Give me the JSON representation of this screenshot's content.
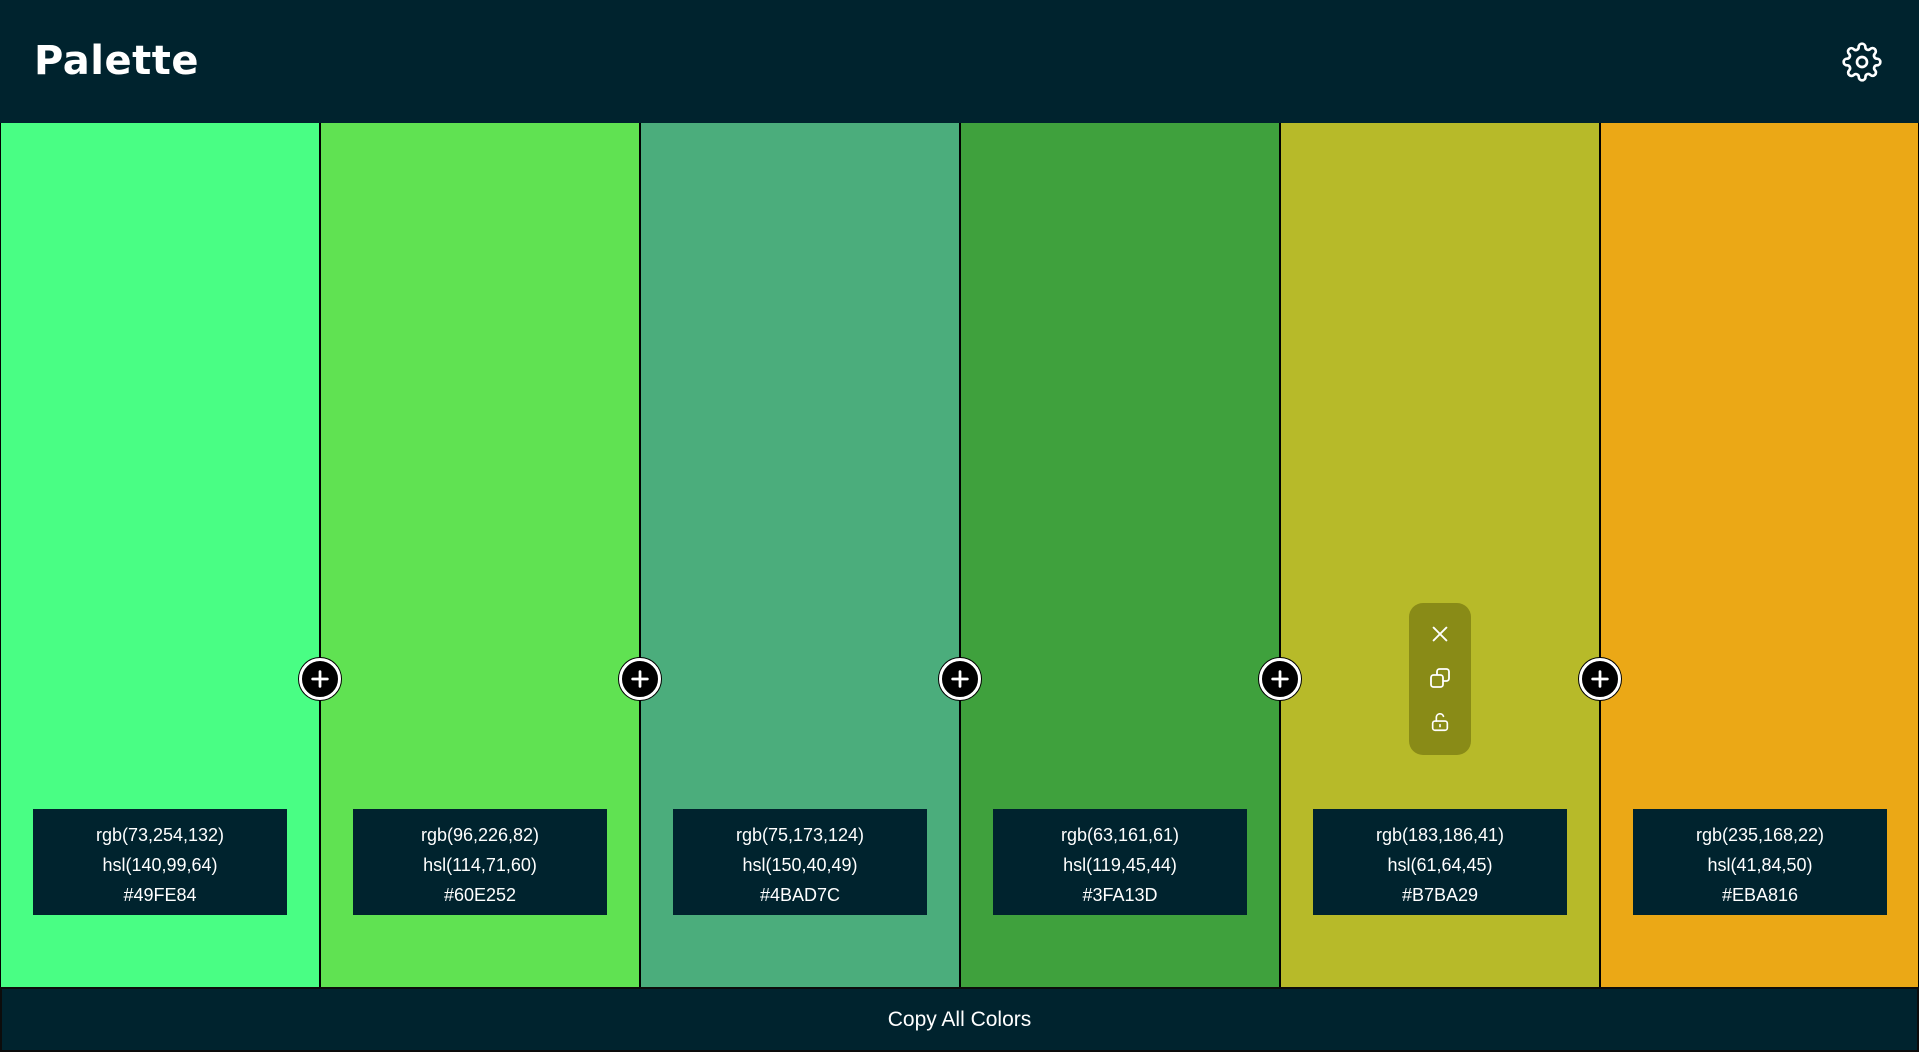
{
  "header": {
    "title": "Palette",
    "settings_icon": "gear-icon"
  },
  "palette": {
    "colors": [
      {
        "hex_value": "#49FE84",
        "rgb": "rgb(73,254,132)",
        "hsl": "hsl(140,99,64)",
        "hex": "#49FE84"
      },
      {
        "hex_value": "#60E252",
        "rgb": "rgb(96,226,82)",
        "hsl": "hsl(114,71,60)",
        "hex": "#60E252"
      },
      {
        "hex_value": "#4BAD7C",
        "rgb": "rgb(75,173,124)",
        "hsl": "hsl(150,40,49)",
        "hex": "#4BAD7C"
      },
      {
        "hex_value": "#3FA13D",
        "rgb": "rgb(63,161,61)",
        "hsl": "hsl(119,45,44)",
        "hex": "#3FA13D"
      },
      {
        "hex_value": "#B7BA29",
        "rgb": "rgb(183,186,41)",
        "hsl": "hsl(61,64,45)",
        "hex": "#B7BA29"
      },
      {
        "hex_value": "#EBA816",
        "rgb": "rgb(235,168,22)",
        "hsl": "hsl(41,84,50)",
        "hex": "#EBA816"
      }
    ],
    "hovered_swatch_tools": [
      "close-icon",
      "copy-icon",
      "unlock-icon"
    ],
    "add_button_icon": "plus-circle-icon"
  },
  "footer": {
    "copy_all_label": "Copy All Colors"
  },
  "theme": {
    "background": "#00232e",
    "text": "#ffffff"
  }
}
